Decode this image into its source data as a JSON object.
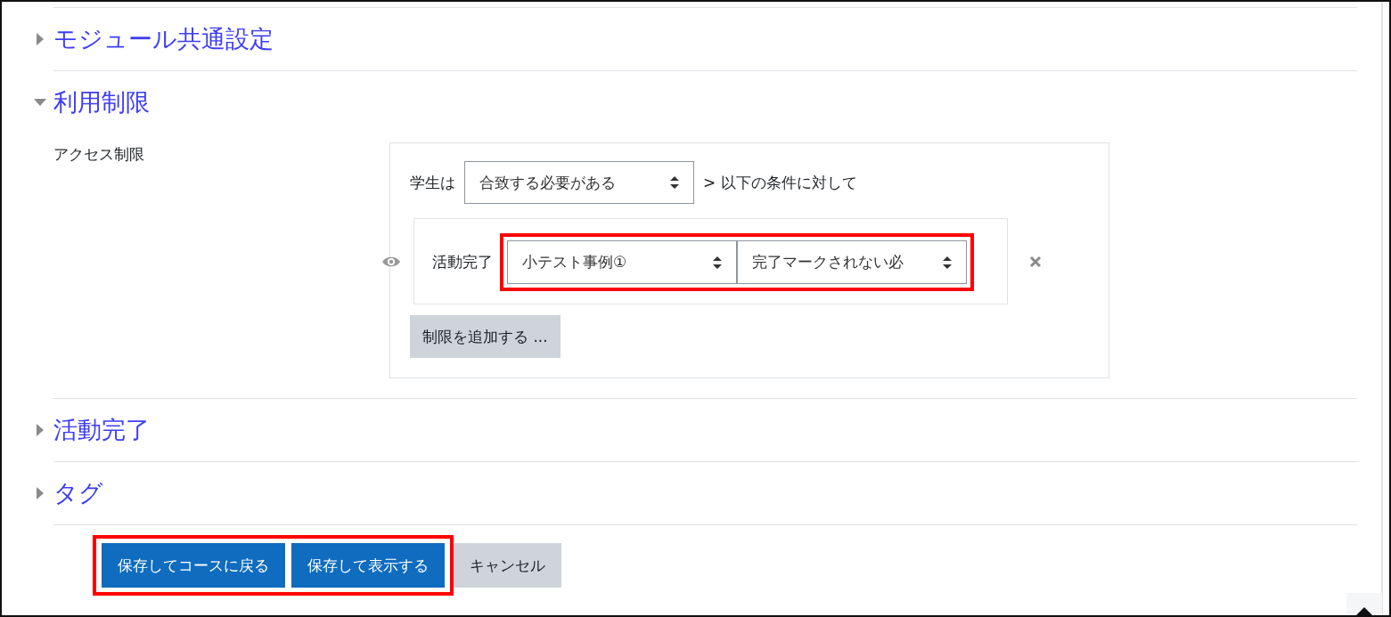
{
  "sections": [
    {
      "title": "モジュール共通設定",
      "expanded": false
    },
    {
      "title": "利用制限",
      "expanded": true,
      "access": {
        "label": "アクセス制限",
        "prefix": "学生は",
        "match": "合致する必要がある",
        "suffix": "> 以下の条件に対して",
        "condition": {
          "label": "活動完了",
          "activity": "小テスト事例①",
          "status": "完了マークされない必",
          "highlighted": true
        },
        "add_button": "制限を追加する ..."
      }
    },
    {
      "title": "活動完了",
      "expanded": false
    },
    {
      "title": "タグ",
      "expanded": false
    }
  ],
  "buttons_highlighted": true,
  "buttons": [
    {
      "label": "保存してコースに戻る",
      "kind": "primary"
    },
    {
      "label": "保存して表示する",
      "kind": "primary"
    },
    {
      "label": "キャンセル",
      "kind": "secondary"
    }
  ]
}
